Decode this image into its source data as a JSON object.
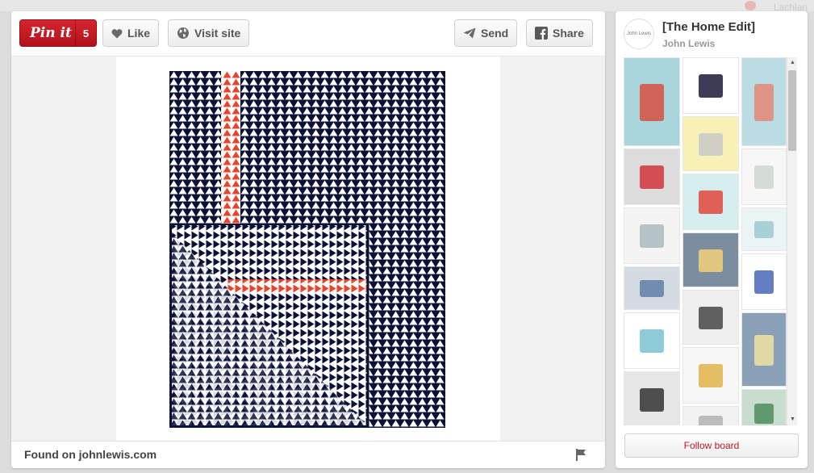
{
  "background": {
    "header_text": "Lachlan"
  },
  "pin": {
    "pin_it_label": "Pin it",
    "pin_count": "5",
    "like_label": "Like",
    "visit_label": "Visit site",
    "send_label": "Send",
    "share_label": "Share",
    "found_on": "Found on johnlewis.com"
  },
  "board": {
    "avatar_text": "John Lewis",
    "title": "[The Home Edit]",
    "owner": "John Lewis",
    "follow_label": "Follow board"
  },
  "colors": {
    "pin_red": "#c8161f",
    "navy": "#0b1236",
    "accent_red": "#e8442b",
    "follow_text": "#c0181f"
  },
  "icons": [
    "heart-icon",
    "visit-site-icon",
    "send-icon",
    "facebook-icon",
    "flag-icon"
  ],
  "thumbnails": [
    {
      "name": "red-blue-mug",
      "bg": "#a8d4dc",
      "fg": "#d95040"
    },
    {
      "name": "striped-throw",
      "bg": "#ffffff",
      "fg": "#1a1a3a"
    },
    {
      "name": "blue-table",
      "bg": "#b9dde3",
      "fg": "#e38775"
    },
    {
      "name": "yellow-cushion",
      "bg": "#f7f1b5",
      "fg": "#c9c9c9"
    },
    {
      "name": "red-lamp",
      "bg": "#dcdcdc",
      "fg": "#d2343a"
    },
    {
      "name": "plates-stack",
      "bg": "#f7f7f7",
      "fg": "#cfd7d0"
    },
    {
      "name": "mug-blue",
      "bg": "#d4eef0",
      "fg": "#e0463b"
    },
    {
      "name": "towels",
      "bg": "#f4f4f4",
      "fg": "#a9b9bf"
    },
    {
      "name": "glass-tumblers",
      "bg": "#eaf4f4",
      "fg": "#9cc9d1"
    },
    {
      "name": "night-lantern",
      "bg": "#7d8da0",
      "fg": "#f2d07a"
    },
    {
      "name": "wine-glass",
      "bg": "#ffffff",
      "fg": "#4a66b8"
    },
    {
      "name": "bowls",
      "bg": "#d4dbe2",
      "fg": "#5e7fa6"
    },
    {
      "name": "pendant-lamp",
      "bg": "#eeeeee",
      "fg": "#454545"
    },
    {
      "name": "blue-tumbler",
      "bg": "#ffffff",
      "fg": "#79c3cf"
    },
    {
      "name": "garden-lights",
      "bg": "#8aa0b6",
      "fg": "#f0e3a0"
    },
    {
      "name": "black-lantern",
      "bg": "#e6e6e6",
      "fg": "#333333"
    },
    {
      "name": "plate-stack-colour",
      "bg": "#f7f7f7",
      "fg": "#e2b34b"
    },
    {
      "name": "kitchen-shelf",
      "bg": "#f2f2f2",
      "fg": "#b3b3b3"
    },
    {
      "name": "party-lights",
      "bg": "#c9dcd0",
      "fg": "#4d8d59"
    }
  ]
}
